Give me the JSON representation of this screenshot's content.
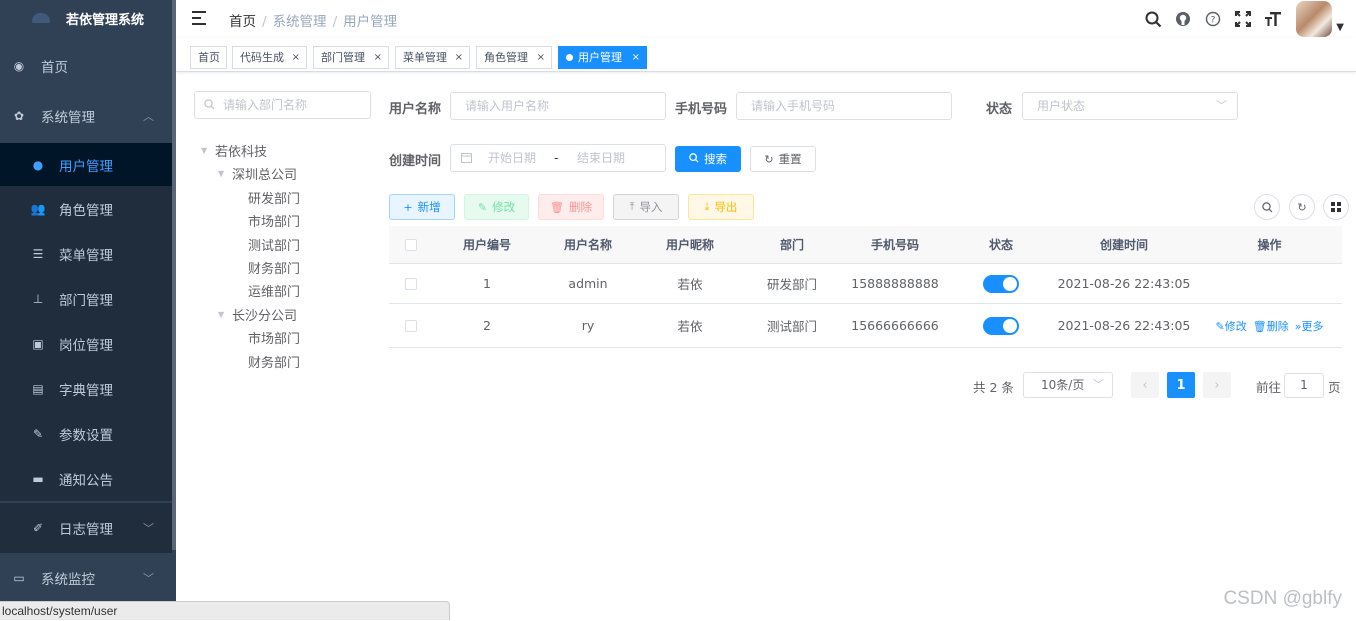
{
  "app": {
    "title": "若依管理系统"
  },
  "sidebar": {
    "items": [
      {
        "label": "首页",
        "icon": "dashboard-icon"
      },
      {
        "label": "系统管理",
        "icon": "gear-icon"
      },
      {
        "label": "用户管理",
        "icon": "user-icon"
      },
      {
        "label": "角色管理",
        "icon": "peoples-icon"
      },
      {
        "label": "菜单管理",
        "icon": "tree-table-icon"
      },
      {
        "label": "部门管理",
        "icon": "tree-icon"
      },
      {
        "label": "岗位管理",
        "icon": "post-icon"
      },
      {
        "label": "字典管理",
        "icon": "dict-icon"
      },
      {
        "label": "参数设置",
        "icon": "edit-icon"
      },
      {
        "label": "通知公告",
        "icon": "message-icon"
      },
      {
        "label": "日志管理",
        "icon": "log-icon"
      },
      {
        "label": "系统监控",
        "icon": "monitor-icon"
      }
    ]
  },
  "statusbar": {
    "url": "localhost/system/user"
  },
  "breadcrumb": {
    "home": "首页",
    "parent": "系统管理",
    "current": "用户管理",
    "sep": "/"
  },
  "tags": [
    {
      "label": "首页"
    },
    {
      "label": "代码生成",
      "close": "×"
    },
    {
      "label": "部门管理",
      "close": "×"
    },
    {
      "label": "菜单管理",
      "close": "×"
    },
    {
      "label": "角色管理",
      "close": "×"
    },
    {
      "label": "用户管理",
      "close": "×"
    }
  ],
  "dept": {
    "search_placeholder": "请输入部门名称",
    "tree": {
      "root": "若依科技",
      "shenzhen": "深圳总公司",
      "sz_children": [
        "研发部门",
        "市场部门",
        "测试部门",
        "财务部门",
        "运维部门"
      ],
      "changsha": "长沙分公司",
      "cs_children": [
        "市场部门",
        "财务部门"
      ]
    }
  },
  "search": {
    "username_label": "用户名称",
    "username_placeholder": "请输入用户名称",
    "phone_label": "手机号码",
    "phone_placeholder": "请输入手机号码",
    "status_label": "状态",
    "status_placeholder": "用户状态",
    "time_label": "创建时间",
    "start_placeholder": "开始日期",
    "range_sep": "-",
    "end_placeholder": "结束日期",
    "search_btn": "搜索",
    "reset_btn": "重置"
  },
  "toolbar": {
    "add": "新增",
    "edit": "修改",
    "delete": "删除",
    "import": "导入",
    "export": "导出"
  },
  "table": {
    "headers": [
      "用户编号",
      "用户名称",
      "用户昵称",
      "部门",
      "手机号码",
      "状态",
      "创建时间",
      "操作"
    ],
    "rows": [
      {
        "id": "1",
        "username": "admin",
        "nickname": "若依",
        "dept": "研发部门",
        "phone": "15888888888",
        "status": true,
        "created": "2021-08-26 22:43:05"
      },
      {
        "id": "2",
        "username": "ry",
        "nickname": "若依",
        "dept": "测试部门",
        "phone": "15666666666",
        "status": true,
        "created": "2021-08-26 22:43:05"
      }
    ],
    "ops": {
      "edit": "修改",
      "delete": "删除",
      "more": "更多"
    }
  },
  "pagination": {
    "total": "共 2 条",
    "page_size": "10条/页",
    "current_page": "1",
    "goto_prefix": "前往",
    "goto_value": "1",
    "goto_suffix": "页"
  },
  "watermark": "CSDN @gblfy",
  "colors": {
    "primary": "#1890ff",
    "sidebar_bg": "#304156",
    "active_bg": "#001528"
  }
}
